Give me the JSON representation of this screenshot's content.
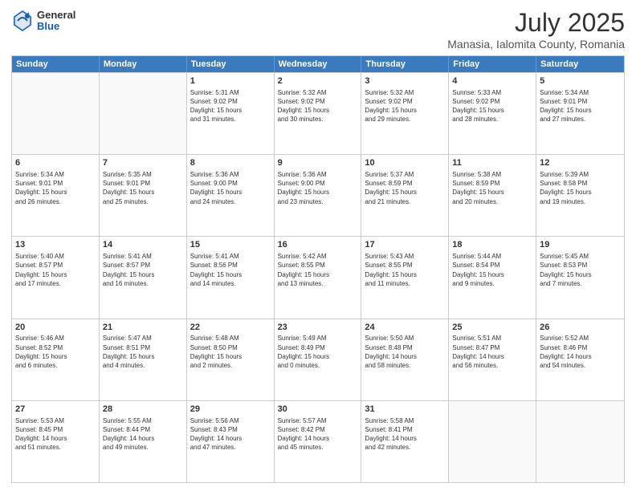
{
  "logo": {
    "general": "General",
    "blue": "Blue"
  },
  "title": "July 2025",
  "subtitle": "Manasia, Ialomita County, Romania",
  "header_days": [
    "Sunday",
    "Monday",
    "Tuesday",
    "Wednesday",
    "Thursday",
    "Friday",
    "Saturday"
  ],
  "weeks": [
    [
      {
        "day": "",
        "info": "",
        "empty": true
      },
      {
        "day": "",
        "info": "",
        "empty": true
      },
      {
        "day": "1",
        "info": "Sunrise: 5:31 AM\nSunset: 9:02 PM\nDaylight: 15 hours\nand 31 minutes.",
        "empty": false
      },
      {
        "day": "2",
        "info": "Sunrise: 5:32 AM\nSunset: 9:02 PM\nDaylight: 15 hours\nand 30 minutes.",
        "empty": false
      },
      {
        "day": "3",
        "info": "Sunrise: 5:32 AM\nSunset: 9:02 PM\nDaylight: 15 hours\nand 29 minutes.",
        "empty": false
      },
      {
        "day": "4",
        "info": "Sunrise: 5:33 AM\nSunset: 9:02 PM\nDaylight: 15 hours\nand 28 minutes.",
        "empty": false
      },
      {
        "day": "5",
        "info": "Sunrise: 5:34 AM\nSunset: 9:01 PM\nDaylight: 15 hours\nand 27 minutes.",
        "empty": false
      }
    ],
    [
      {
        "day": "6",
        "info": "Sunrise: 5:34 AM\nSunset: 9:01 PM\nDaylight: 15 hours\nand 26 minutes.",
        "empty": false
      },
      {
        "day": "7",
        "info": "Sunrise: 5:35 AM\nSunset: 9:01 PM\nDaylight: 15 hours\nand 25 minutes.",
        "empty": false
      },
      {
        "day": "8",
        "info": "Sunrise: 5:36 AM\nSunset: 9:00 PM\nDaylight: 15 hours\nand 24 minutes.",
        "empty": false
      },
      {
        "day": "9",
        "info": "Sunrise: 5:36 AM\nSunset: 9:00 PM\nDaylight: 15 hours\nand 23 minutes.",
        "empty": false
      },
      {
        "day": "10",
        "info": "Sunrise: 5:37 AM\nSunset: 8:59 PM\nDaylight: 15 hours\nand 21 minutes.",
        "empty": false
      },
      {
        "day": "11",
        "info": "Sunrise: 5:38 AM\nSunset: 8:59 PM\nDaylight: 15 hours\nand 20 minutes.",
        "empty": false
      },
      {
        "day": "12",
        "info": "Sunrise: 5:39 AM\nSunset: 8:58 PM\nDaylight: 15 hours\nand 19 minutes.",
        "empty": false
      }
    ],
    [
      {
        "day": "13",
        "info": "Sunrise: 5:40 AM\nSunset: 8:57 PM\nDaylight: 15 hours\nand 17 minutes.",
        "empty": false
      },
      {
        "day": "14",
        "info": "Sunrise: 5:41 AM\nSunset: 8:57 PM\nDaylight: 15 hours\nand 16 minutes.",
        "empty": false
      },
      {
        "day": "15",
        "info": "Sunrise: 5:41 AM\nSunset: 8:56 PM\nDaylight: 15 hours\nand 14 minutes.",
        "empty": false
      },
      {
        "day": "16",
        "info": "Sunrise: 5:42 AM\nSunset: 8:55 PM\nDaylight: 15 hours\nand 13 minutes.",
        "empty": false
      },
      {
        "day": "17",
        "info": "Sunrise: 5:43 AM\nSunset: 8:55 PM\nDaylight: 15 hours\nand 11 minutes.",
        "empty": false
      },
      {
        "day": "18",
        "info": "Sunrise: 5:44 AM\nSunset: 8:54 PM\nDaylight: 15 hours\nand 9 minutes.",
        "empty": false
      },
      {
        "day": "19",
        "info": "Sunrise: 5:45 AM\nSunset: 8:53 PM\nDaylight: 15 hours\nand 7 minutes.",
        "empty": false
      }
    ],
    [
      {
        "day": "20",
        "info": "Sunrise: 5:46 AM\nSunset: 8:52 PM\nDaylight: 15 hours\nand 6 minutes.",
        "empty": false
      },
      {
        "day": "21",
        "info": "Sunrise: 5:47 AM\nSunset: 8:51 PM\nDaylight: 15 hours\nand 4 minutes.",
        "empty": false
      },
      {
        "day": "22",
        "info": "Sunrise: 5:48 AM\nSunset: 8:50 PM\nDaylight: 15 hours\nand 2 minutes.",
        "empty": false
      },
      {
        "day": "23",
        "info": "Sunrise: 5:49 AM\nSunset: 8:49 PM\nDaylight: 15 hours\nand 0 minutes.",
        "empty": false
      },
      {
        "day": "24",
        "info": "Sunrise: 5:50 AM\nSunset: 8:48 PM\nDaylight: 14 hours\nand 58 minutes.",
        "empty": false
      },
      {
        "day": "25",
        "info": "Sunrise: 5:51 AM\nSunset: 8:47 PM\nDaylight: 14 hours\nand 56 minutes.",
        "empty": false
      },
      {
        "day": "26",
        "info": "Sunrise: 5:52 AM\nSunset: 8:46 PM\nDaylight: 14 hours\nand 54 minutes.",
        "empty": false
      }
    ],
    [
      {
        "day": "27",
        "info": "Sunrise: 5:53 AM\nSunset: 8:45 PM\nDaylight: 14 hours\nand 51 minutes.",
        "empty": false
      },
      {
        "day": "28",
        "info": "Sunrise: 5:55 AM\nSunset: 8:44 PM\nDaylight: 14 hours\nand 49 minutes.",
        "empty": false
      },
      {
        "day": "29",
        "info": "Sunrise: 5:56 AM\nSunset: 8:43 PM\nDaylight: 14 hours\nand 47 minutes.",
        "empty": false
      },
      {
        "day": "30",
        "info": "Sunrise: 5:57 AM\nSunset: 8:42 PM\nDaylight: 14 hours\nand 45 minutes.",
        "empty": false
      },
      {
        "day": "31",
        "info": "Sunrise: 5:58 AM\nSunset: 8:41 PM\nDaylight: 14 hours\nand 42 minutes.",
        "empty": false
      },
      {
        "day": "",
        "info": "",
        "empty": true
      },
      {
        "day": "",
        "info": "",
        "empty": true
      }
    ]
  ]
}
